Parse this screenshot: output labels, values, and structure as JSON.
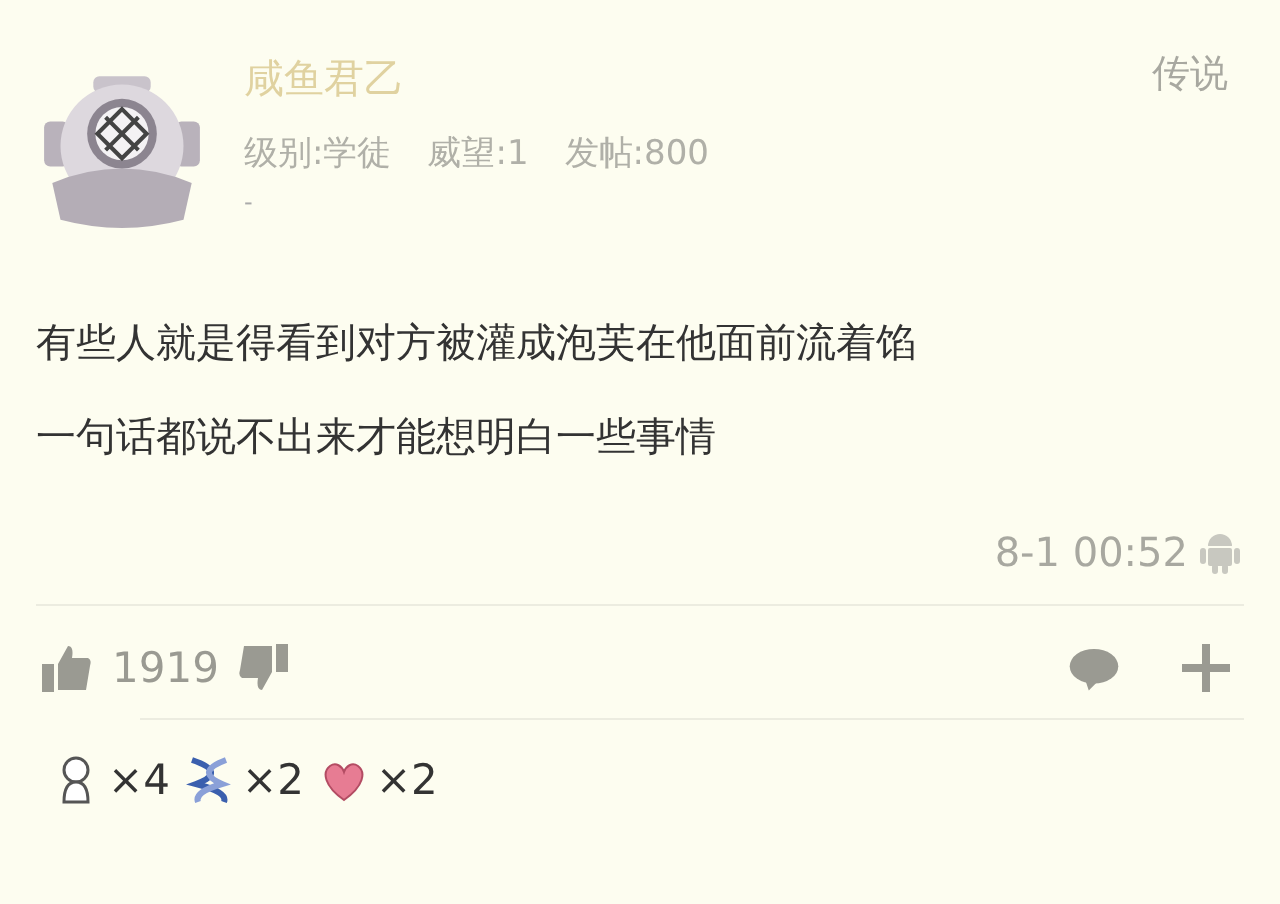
{
  "author": {
    "name": "咸鱼君乙",
    "rank": "传说",
    "stats": [
      "级别:学徒",
      "威望:1",
      "发帖:800"
    ],
    "signature": "-"
  },
  "post": {
    "lines": [
      "有些人就是得看到对方被灌成泡芙在他面前流着馅",
      "一句话都说不出来才能想明白一些事情"
    ],
    "time": "8-1 00:52"
  },
  "actions": {
    "likes": "1919"
  },
  "reactions": [
    {
      "kind": "figure",
      "count": "×4"
    },
    {
      "kind": "dna",
      "count": "×2"
    },
    {
      "kind": "heart",
      "count": "×2"
    }
  ]
}
